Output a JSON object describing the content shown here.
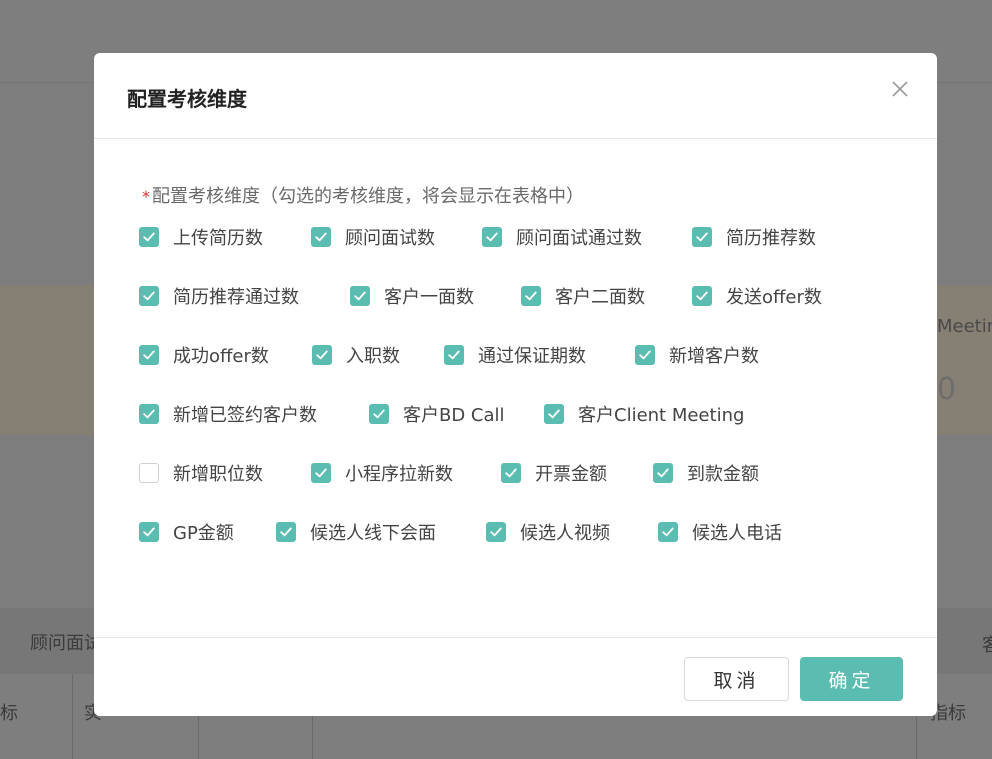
{
  "background": {
    "fragments": [
      {
        "text": "顾问面试"
      },
      {
        "text": "Meeting"
      },
      {
        "text": "0"
      },
      {
        "text": "客"
      },
      {
        "text": "标"
      },
      {
        "text": "实"
      },
      {
        "text": "指标"
      }
    ]
  },
  "modal": {
    "title": "配置考核维度",
    "field_label": "配置考核维度（勾选的考核维度，将会显示在表格中）",
    "required_star": "*",
    "checkboxes": [
      {
        "label": "上传简历数",
        "checked": true
      },
      {
        "label": "顾问面试数",
        "checked": true
      },
      {
        "label": "顾问面试通过数",
        "checked": true
      },
      {
        "label": "简历推荐数",
        "checked": true
      },
      {
        "label": "简历推荐通过数",
        "checked": true
      },
      {
        "label": "客户一面数",
        "checked": true
      },
      {
        "label": "客户二面数",
        "checked": true
      },
      {
        "label": "发送offer数",
        "checked": true
      },
      {
        "label": "成功offer数",
        "checked": true
      },
      {
        "label": "入职数",
        "checked": true
      },
      {
        "label": "通过保证期数",
        "checked": true
      },
      {
        "label": "新增客户数",
        "checked": true
      },
      {
        "label": "新增已签约客户数",
        "checked": true
      },
      {
        "label": "客户BD Call",
        "checked": true
      },
      {
        "label": "客户Client Meeting",
        "checked": true
      },
      {
        "label": "新增职位数",
        "checked": false
      },
      {
        "label": "小程序拉新数",
        "checked": true
      },
      {
        "label": "开票金额",
        "checked": true
      },
      {
        "label": "到款金额",
        "checked": true
      },
      {
        "label": "GP金额",
        "checked": true
      },
      {
        "label": "候选人线下会面",
        "checked": true
      },
      {
        "label": "候选人视频",
        "checked": true
      },
      {
        "label": "候选人电话",
        "checked": true
      }
    ],
    "buttons": {
      "cancel": "取消",
      "ok": "确定"
    }
  },
  "colors": {
    "accent": "#5bbcb1",
    "required": "#e2332d",
    "overlay": "#7d7d7d"
  }
}
